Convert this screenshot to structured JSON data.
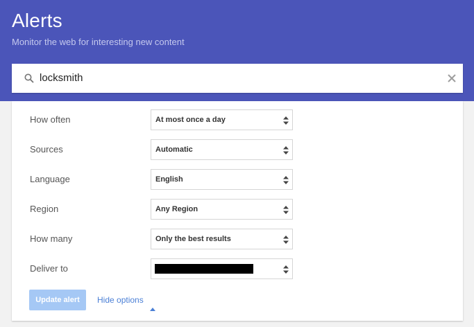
{
  "header": {
    "title": "Alerts",
    "subtitle": "Monitor the web for interesting new content"
  },
  "search": {
    "query": "locksmith",
    "search_icon": "search-icon",
    "clear_icon": "close-icon"
  },
  "options": [
    {
      "label": "How often",
      "value": "At most once a day"
    },
    {
      "label": "Sources",
      "value": "Automatic"
    },
    {
      "label": "Language",
      "value": "English"
    },
    {
      "label": "Region",
      "value": "Any Region"
    },
    {
      "label": "How many",
      "value": "Only the best results"
    },
    {
      "label": "Deliver to",
      "value": ""
    }
  ],
  "actions": {
    "update_label": "Update alert",
    "hide_options_label": "Hide options"
  },
  "colors": {
    "header_bg": "#4b55b9",
    "update_button_bg": "#a5c8f5",
    "link": "#4a7fd6"
  }
}
